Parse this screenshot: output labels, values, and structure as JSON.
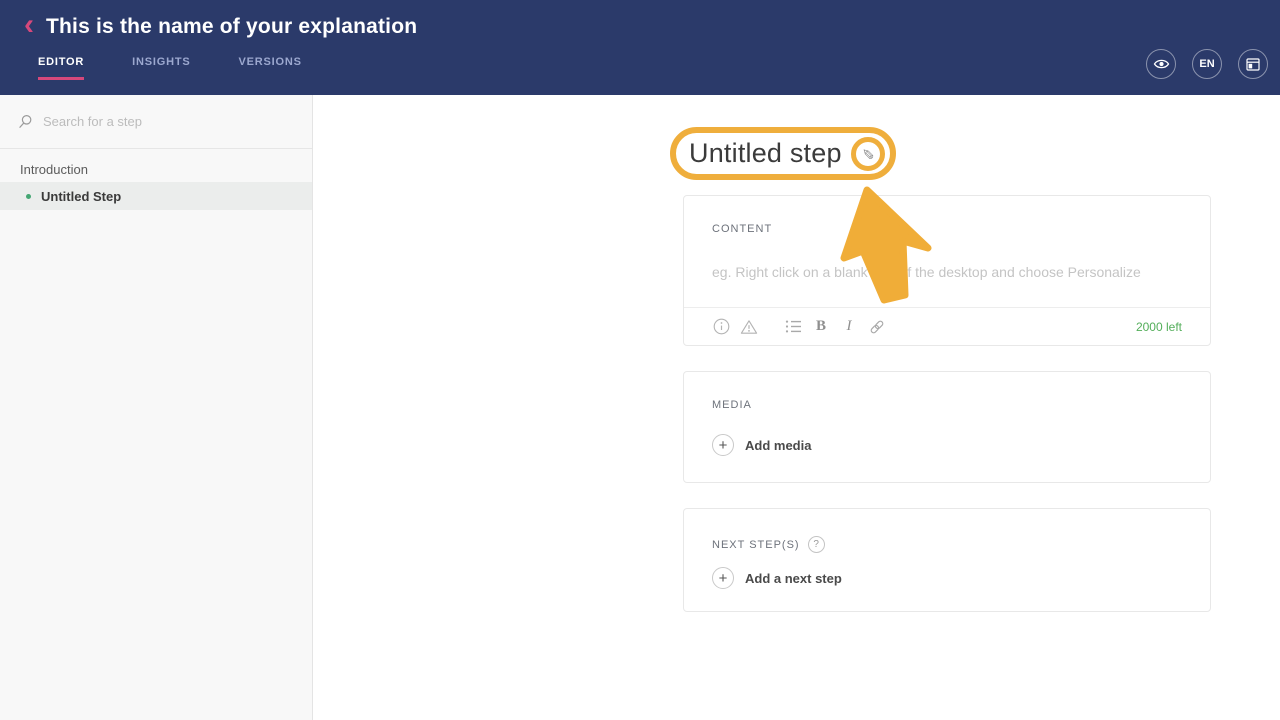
{
  "header": {
    "back_glyph": "‹",
    "title": "This is the name of your explanation",
    "tabs": [
      {
        "label": "EDITOR",
        "active": true
      },
      {
        "label": "INSIGHTS",
        "active": false
      },
      {
        "label": "VERSIONS",
        "active": false
      }
    ],
    "actions": {
      "preview_icon": "eye-icon",
      "language_label": "EN",
      "layout_icon": "layout-icon"
    }
  },
  "sidebar": {
    "search_placeholder": "Search for a step",
    "section_title": "Introduction",
    "steps": [
      {
        "label": "Untitled Step",
        "selected": true,
        "status_dot_color": "#44a673"
      }
    ]
  },
  "main": {
    "step_title": "Untitled step",
    "edit_icon": "pencil-icon",
    "pencil_glyph": "✎",
    "content_card": {
      "label": "CONTENT",
      "placeholder": "eg. Right click on a blank part of the desktop and choose Personalize",
      "chars_left": "2000 left",
      "toolbar_icons": [
        {
          "name": "info-icon"
        },
        {
          "name": "warning-icon"
        },
        {
          "name": "list-icon"
        },
        {
          "name": "bold-icon",
          "glyph": "B"
        },
        {
          "name": "italic-icon",
          "glyph": "I"
        },
        {
          "name": "link-icon"
        }
      ]
    },
    "media_card": {
      "label": "MEDIA",
      "plus_glyph": "+",
      "add_label": "Add media"
    },
    "next_card": {
      "label": "NEXT STEP(S)",
      "help_glyph": "?",
      "plus_glyph": "+",
      "add_label": "Add a next step"
    },
    "cursor": "large-yellow-pointer"
  },
  "colors": {
    "header_bg": "#2b3a6a",
    "accent_pink": "#d6487b",
    "highlight_yellow": "#efae3c",
    "chars_green": "#53ae5a",
    "step_dot_green": "#44a673",
    "sidebar_bg": "#f8f8f8",
    "selected_row_bg": "#ebedec"
  }
}
